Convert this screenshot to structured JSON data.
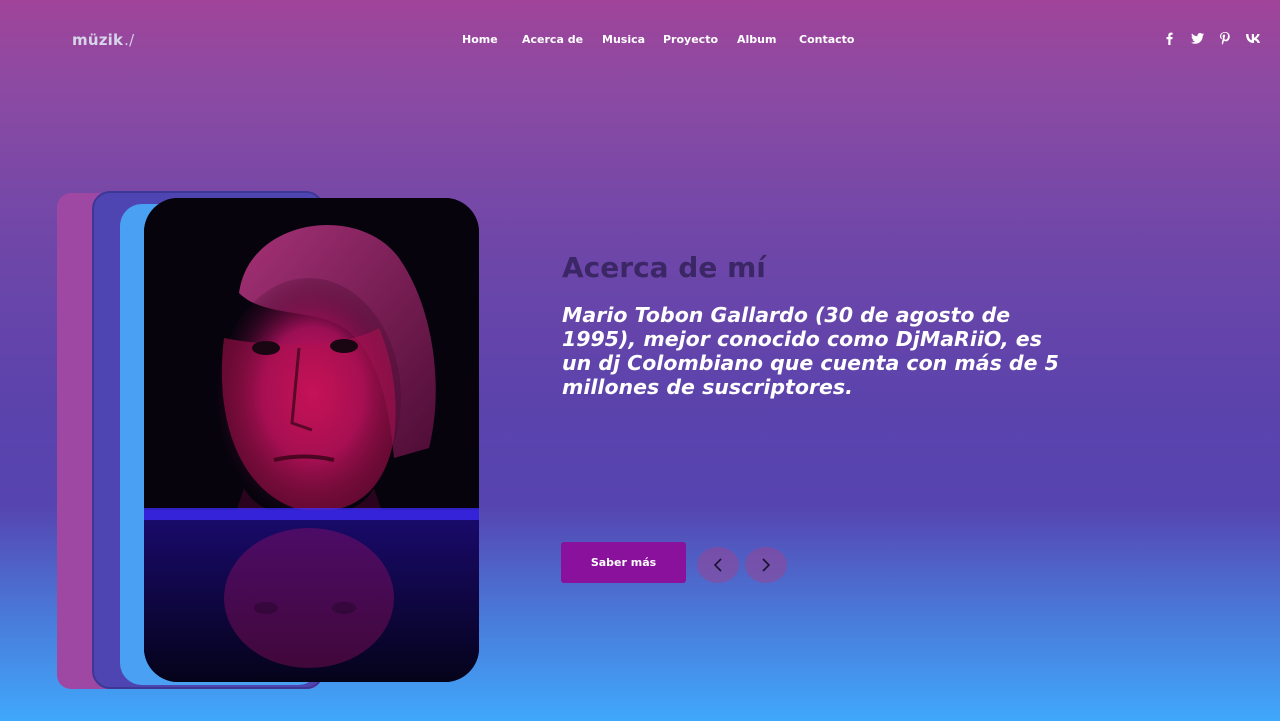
{
  "brand": {
    "name": "müzik",
    "suffix": "./"
  },
  "nav": {
    "items": [
      {
        "label": "Home"
      },
      {
        "label": "Acerca de"
      },
      {
        "label": "Musica"
      },
      {
        "label": "Proyecto"
      },
      {
        "label": "Album"
      },
      {
        "label": "Contacto"
      }
    ]
  },
  "social": [
    {
      "icon": "facebook-icon",
      "glyph": "f"
    },
    {
      "icon": "twitter-icon",
      "glyph": "t"
    },
    {
      "icon": "pinterest-icon",
      "glyph": "p"
    },
    {
      "icon": "vk-icon",
      "glyph": "vk"
    }
  ],
  "about": {
    "heading": "Acerca de mí",
    "description": "Mario Tobon Gallardo (30 de agosto de 1995), mejor conocido como DjMaRiiO, es un dj Colombiano que cuenta con más de 5 millones de suscriptores.",
    "button_label": "Saber más"
  },
  "slider": {
    "prev_icon": "chevron-left-icon",
    "next_icon": "chevron-right-icon"
  },
  "colors": {
    "accent": "#89119b",
    "heading": "#3c2766",
    "background_top": "#a04499",
    "background_bottom": "#40a8fb"
  }
}
